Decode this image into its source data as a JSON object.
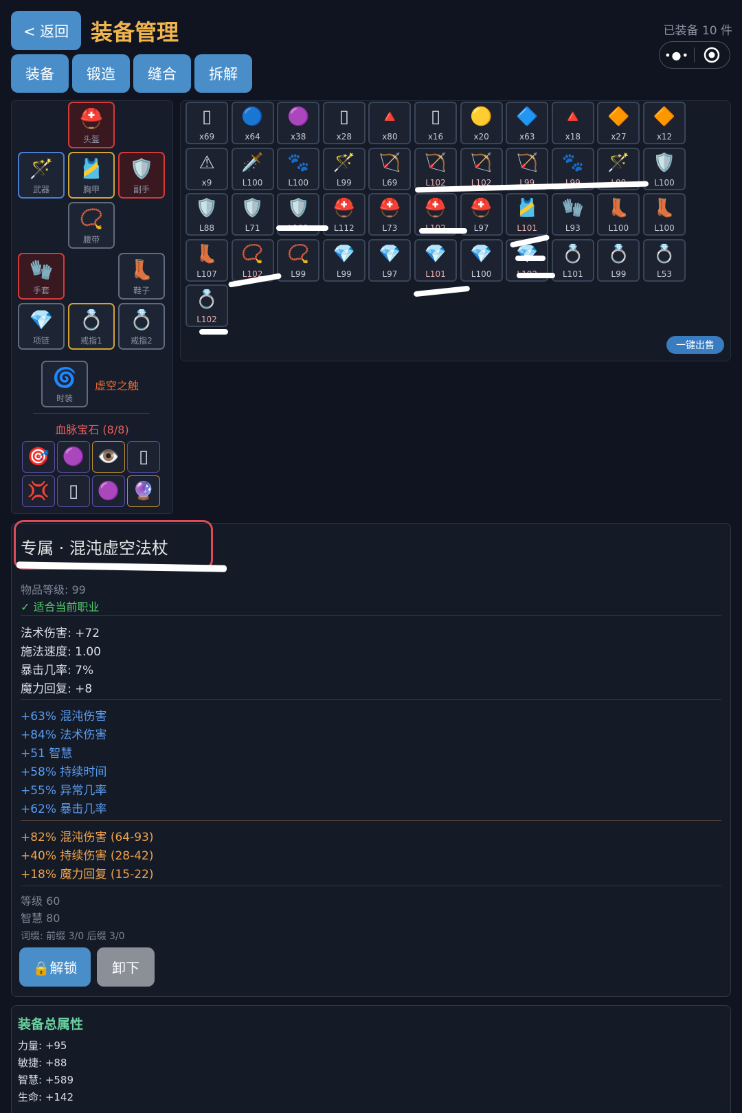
{
  "header": {
    "back_label": "< 返回",
    "title": "装备管理",
    "equipped_count": "已装备 10 件",
    "tabs": [
      "装备",
      "锻造",
      "缝合",
      "拆解"
    ]
  },
  "slots": {
    "helmet": {
      "label": "头盔",
      "icon": "⛑️"
    },
    "weapon": {
      "label": "武器",
      "icon": "🪄"
    },
    "chest": {
      "label": "胸甲",
      "icon": "🎽"
    },
    "offhand": {
      "label": "副手",
      "icon": "🛡️"
    },
    "belt": {
      "label": "腰带",
      "icon": "📿"
    },
    "gloves": {
      "label": "手套",
      "icon": "🧤"
    },
    "boots": {
      "label": "鞋子",
      "icon": "👢"
    },
    "necklace": {
      "label": "项链",
      "icon": "💎"
    },
    "ring1": {
      "label": "戒指1",
      "icon": "💍"
    },
    "ring2": {
      "label": "戒指2",
      "icon": "💍"
    },
    "fashion": {
      "label": "时装",
      "icon": "🌀",
      "name": "虚空之触"
    }
  },
  "gems": {
    "title": "血脉宝石 (8/8)",
    "items": [
      "🎯",
      "🟣",
      "👁️",
      "▯",
      "💢",
      "▯",
      "🟣",
      "🔮"
    ]
  },
  "inventory": {
    "rows": [
      [
        {
          "i": "▯",
          "l": "x69",
          "c": "b"
        },
        {
          "i": "🔵",
          "l": "x64",
          "c": "b"
        },
        {
          "i": "🟣",
          "l": "x38",
          "c": "p"
        },
        {
          "i": "▯",
          "l": "x28",
          "c": "p"
        },
        {
          "i": "🔺",
          "l": "x80",
          "c": "b"
        },
        {
          "i": "▯",
          "l": "x16",
          "c": "y"
        },
        {
          "i": "🟡",
          "l": "x20",
          "c": "y"
        },
        {
          "i": "🔷",
          "l": "x63",
          "c": "b"
        },
        {
          "i": "🔺",
          "l": "x18",
          "c": "p"
        },
        {
          "i": "🔶",
          "l": "x27",
          "c": "p"
        },
        {
          "i": "🔶",
          "l": "x12",
          "c": "y"
        }
      ],
      [
        {
          "i": "⚠",
          "l": "x9",
          "c": "y"
        },
        {
          "i": "🗡️",
          "l": "L100",
          "c": "g"
        },
        {
          "i": "🐾",
          "l": "L100",
          "c": "g"
        },
        {
          "i": "🪄",
          "l": "L99",
          "c": "y"
        },
        {
          "i": "🏹",
          "l": "L69",
          "c": "y"
        },
        {
          "i": "🏹",
          "l": "L102",
          "c": "r"
        },
        {
          "i": "🏹",
          "l": "L102",
          "c": "r"
        },
        {
          "i": "🏹",
          "l": "L99",
          "c": "r"
        },
        {
          "i": "🐾",
          "l": "L99",
          "c": "r"
        },
        {
          "i": "🪄",
          "l": "L99",
          "c": "r"
        },
        {
          "i": "🛡️",
          "l": "L100",
          "c": "y"
        }
      ],
      [
        {
          "i": "🛡️",
          "l": "L88",
          "c": "y"
        },
        {
          "i": "🛡️",
          "l": "L71",
          "c": "y"
        },
        {
          "i": "🛡️",
          "l": "L102",
          "c": "r"
        },
        {
          "i": "⛑️",
          "l": "L112",
          "c": "y"
        },
        {
          "i": "⛑️",
          "l": "L73",
          "c": "y"
        },
        {
          "i": "⛑️",
          "l": "L102",
          "c": "r"
        },
        {
          "i": "⛑️",
          "l": "L97",
          "c": "p"
        },
        {
          "i": "🎽",
          "l": "L101",
          "c": "r"
        },
        {
          "i": "🧤",
          "l": "L93",
          "c": "y"
        },
        {
          "i": "👢",
          "l": "L100",
          "c": "y"
        },
        {
          "i": "👢",
          "l": "L100",
          "c": "y"
        }
      ],
      [
        {
          "i": "👢",
          "l": "L107",
          "c": "y"
        },
        {
          "i": "📿",
          "l": "L102",
          "c": "r"
        },
        {
          "i": "📿",
          "l": "L99",
          "c": "p"
        },
        {
          "i": "💎",
          "l": "L99",
          "c": "g"
        },
        {
          "i": "💎",
          "l": "L97",
          "c": "g"
        },
        {
          "i": "💎",
          "l": "L101",
          "c": "r"
        },
        {
          "i": "💎",
          "l": "L100",
          "c": "p"
        },
        {
          "i": "💎",
          "l": "L102",
          "c": "r"
        },
        {
          "i": "💍",
          "l": "L101",
          "c": "g"
        },
        {
          "i": "💍",
          "l": "L99",
          "c": "y"
        },
        {
          "i": "💍",
          "l": "L53",
          "c": "y"
        }
      ],
      [
        {
          "i": "💍",
          "l": "L102",
          "c": "r"
        }
      ]
    ],
    "sell_all_label": "一键出售"
  },
  "detail": {
    "name": "专属 · 混沌虚空法杖",
    "item_level": "物品等级: 99",
    "class_fit": "✓ 适合当前职业",
    "base_stats": [
      "法术伤害: +72",
      "施法速度: 1.00",
      "暴击几率: 7%",
      "魔力回复: +8"
    ],
    "affixes": [
      "+63% 混沌伤害",
      "+84% 法术伤害",
      "+51 智慧",
      "+58% 持续时间",
      "+55% 异常几率",
      "+62% 暴击几率"
    ],
    "special": [
      "+82% 混沌伤害 (64-93)",
      "+40% 持续伤害 (28-42)",
      "+18% 魔力回复 (15-22)"
    ],
    "requirements": [
      "等级 60",
      "智慧 80"
    ],
    "affix_slots": "词缀: 前缀 3/0  后缀 3/0",
    "unlock_label": "🔒解锁",
    "unequip_label": "卸下"
  },
  "totals": {
    "title": "装备总属性",
    "stats": [
      "力量: +95",
      "敏捷: +88",
      "智慧: +589",
      "生命: +142"
    ]
  }
}
